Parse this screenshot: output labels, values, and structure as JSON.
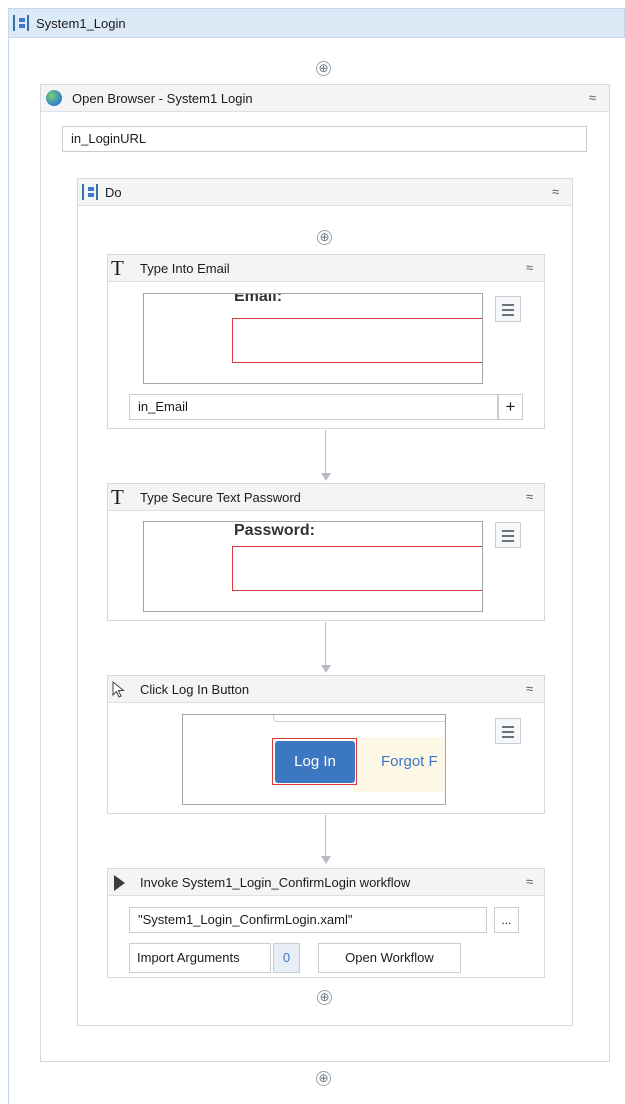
{
  "root": {
    "title": "System1_Login",
    "collapse_glyph": "≈"
  },
  "browser": {
    "title": "Open Browser - System1 Login",
    "url_field": "in_LoginURL",
    "icon": "globe-icon"
  },
  "do_seq": {
    "title": "Do"
  },
  "type_email": {
    "title": "Type Into Email",
    "icon_glyph": "T",
    "preview_label": "Email:",
    "text_field": "in_Email",
    "add_glyph": "+"
  },
  "type_password": {
    "title": "Type Secure Text Password",
    "icon_glyph": "T",
    "preview_label": "Password:"
  },
  "click_login": {
    "title": "Click Log In Button",
    "icon": "cursor-icon",
    "preview_button": "Log In",
    "preview_link": "Forgot F"
  },
  "invoke": {
    "title": "Invoke System1_Login_ConfirmLogin workflow",
    "workflow_file": "\"System1_Login_ConfirmLogin.xaml\"",
    "browse_glyph": "...",
    "import_label": "Import Arguments",
    "import_count": "0",
    "open_label": "Open Workflow"
  },
  "glyphs": {
    "collapse": "≈",
    "add": "⊕"
  },
  "colors": {
    "header_bg": "#dce9f7",
    "selector_red": "#d63a3a",
    "login_blue": "#3c78c2"
  }
}
